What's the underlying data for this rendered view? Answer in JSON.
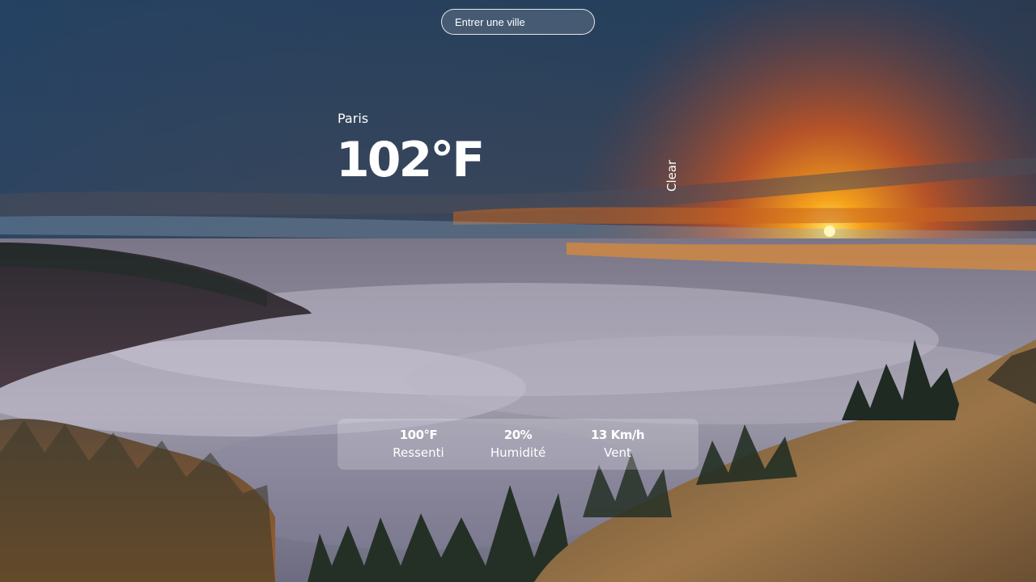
{
  "search": {
    "placeholder": "Entrer une ville",
    "value": ""
  },
  "weather": {
    "city": "Paris",
    "temperature": "102°F",
    "condition": "Clear"
  },
  "details": {
    "feels_like": {
      "value": "100°F",
      "label": "Ressenti"
    },
    "humidity": {
      "value": "20%",
      "label": "Humidité"
    },
    "wind": {
      "value": "13 Km/h",
      "label": "Vent"
    }
  },
  "background": {
    "subject": "sunset over sea of clouds with forested hills",
    "sky_top": "#1c3d5e",
    "sunset": "#f08a1e",
    "fog": "#b9b6c6",
    "hill": "#8a6a44"
  }
}
